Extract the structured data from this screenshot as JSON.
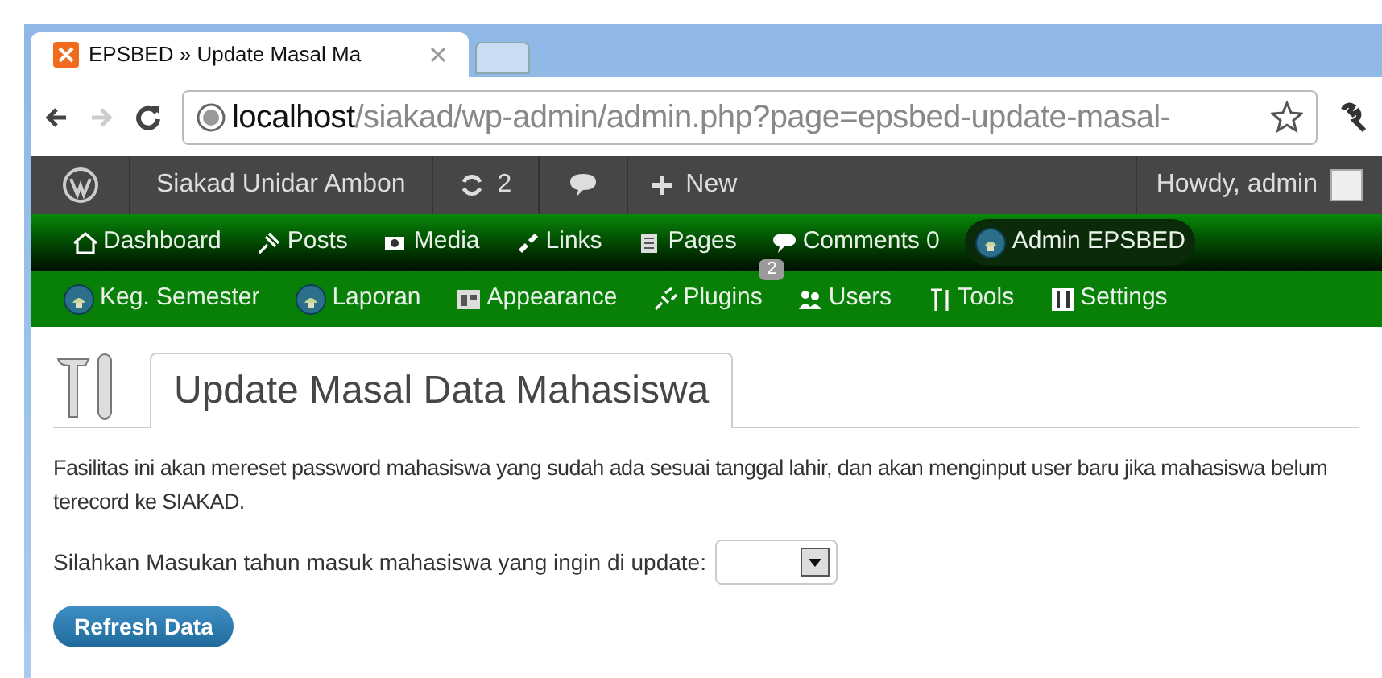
{
  "browser": {
    "tab_title": "EPSBED » Update Masal Ma",
    "url_host": "localhost",
    "url_path": "/siakad/wp-admin/admin.php?page=epsbed-update-masal-"
  },
  "admin_bar": {
    "site": "Siakad Unidar Ambon",
    "updates": "2",
    "new": "New",
    "greeting": "Howdy, admin"
  },
  "menu": [
    {
      "label": "Dashboard",
      "selected": false
    },
    {
      "label": "Posts",
      "selected": false
    },
    {
      "label": "Media",
      "selected": false
    },
    {
      "label": "Links",
      "selected": false
    },
    {
      "label": "Pages",
      "selected": false
    },
    {
      "label": "Comments 0",
      "selected": false
    },
    {
      "label": "Admin EPSBED",
      "selected": true
    },
    {
      "label": "Keg. Semester",
      "selected": false
    },
    {
      "label": "Laporan",
      "selected": false
    },
    {
      "label": "Appearance",
      "selected": false
    },
    {
      "label": "Plugins",
      "selected": false,
      "badge": "2"
    },
    {
      "label": "Users",
      "selected": false
    },
    {
      "label": "Tools",
      "selected": false
    },
    {
      "label": "Settings",
      "selected": false
    }
  ],
  "page": {
    "title": "Update Masal Data Mahasiswa",
    "description": "Fasilitas ini akan mereset password mahasiswa yang sudah ada sesuai tanggal lahir, dan akan menginput user baru jika mahasiswa belum terecord ke SIAKAD.",
    "year_label": "Silahkan Masukan tahun masuk mahasiswa yang ingin di update:",
    "button": "Refresh Data"
  }
}
